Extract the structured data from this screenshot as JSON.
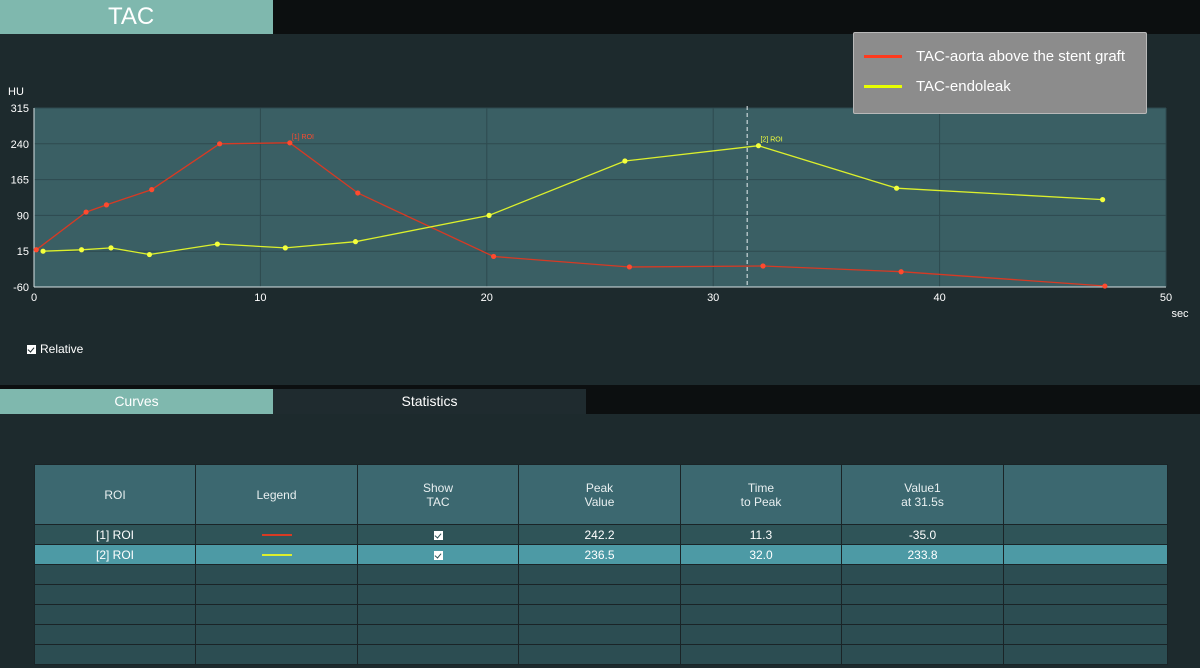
{
  "title": "TAC",
  "relative_label": "Relative",
  "relative_checked": true,
  "tabs": [
    {
      "label": "Curves",
      "active": true
    },
    {
      "label": "Statistics",
      "active": false
    }
  ],
  "legend": [
    {
      "label": "TAC-aorta above the stent graft",
      "color": "#ff3a1e"
    },
    {
      "label": "TAC-endoleak",
      "color": "#e8ff00"
    }
  ],
  "chart_data": {
    "type": "line",
    "ylabel": "HU",
    "xlabel": "sec",
    "xlim": [
      0,
      50
    ],
    "ylim": [
      -60,
      315
    ],
    "x_ticks": [
      0,
      10,
      20,
      30,
      40,
      50
    ],
    "y_ticks": [
      -60,
      15,
      90,
      165,
      240,
      315
    ],
    "cursor_x": 31.5,
    "series": [
      {
        "name": "[1] ROI",
        "color": "#d73a24",
        "marker_color": "#ff4a2e",
        "points": [
          [
            0.1,
            18
          ],
          [
            2.3,
            97
          ],
          [
            3.2,
            112
          ],
          [
            5.2,
            144
          ],
          [
            8.2,
            240
          ],
          [
            11.3,
            242
          ],
          [
            14.3,
            137
          ],
          [
            20.3,
            4
          ],
          [
            26.3,
            -18
          ],
          [
            32.2,
            -16
          ],
          [
            38.3,
            -28
          ],
          [
            47.3,
            -58
          ]
        ]
      },
      {
        "name": "[2] ROI",
        "color": "#dcf02c",
        "marker_color": "#f4ff3c",
        "points": [
          [
            0.4,
            15
          ],
          [
            2.1,
            18
          ],
          [
            3.4,
            22
          ],
          [
            5.1,
            8
          ],
          [
            8.1,
            30
          ],
          [
            11.1,
            22
          ],
          [
            14.2,
            35
          ],
          [
            20.1,
            90
          ],
          [
            26.1,
            204
          ],
          [
            32.0,
            236
          ],
          [
            38.1,
            147
          ],
          [
            47.2,
            123
          ]
        ]
      }
    ]
  },
  "table": {
    "headers": [
      "ROI",
      "Legend",
      "Show\nTAC",
      "Peak\nValue",
      "Time\nto Peak",
      "Value1\nat 31.5s",
      ""
    ],
    "rows": [
      {
        "roi": "[1] ROI",
        "legend_color": "#d73a24",
        "show": true,
        "peak": "242.2",
        "time": "11.3",
        "value1": "-35.0"
      },
      {
        "roi": "[2] ROI",
        "legend_color": "#dcf02c",
        "show": true,
        "peak": "236.5",
        "time": "32.0",
        "value1": "233.8"
      }
    ]
  }
}
